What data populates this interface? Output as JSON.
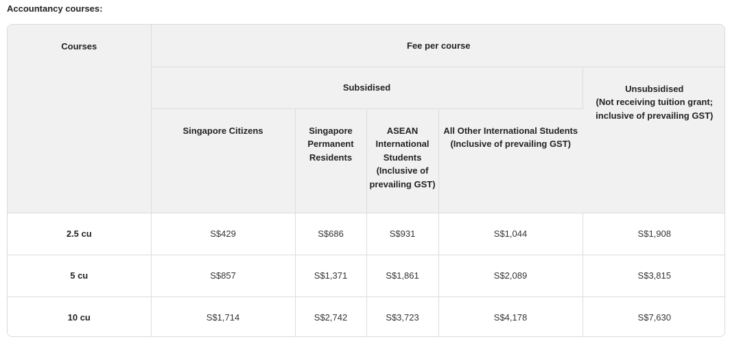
{
  "caption": "Accountancy courses:",
  "header": {
    "courses": "Courses",
    "fee_per_course": "Fee per course",
    "subsidised": "Subsidised",
    "unsubsidised_line1": "Unsubsidised",
    "unsubsidised_line2": "(Not receiving tuition grant;",
    "unsubsidised_line3": "inclusive of prevailing GST)",
    "columns": [
      {
        "lines": [
          "Singapore Citizens"
        ]
      },
      {
        "lines": [
          "Singapore",
          "Permanent",
          "Residents"
        ]
      },
      {
        "lines": [
          "ASEAN",
          "International",
          "Students",
          "(Inclusive of",
          "prevailing GST)"
        ]
      },
      {
        "lines": [
          "All Other International Students",
          "(Inclusive of prevailing GST)"
        ]
      }
    ]
  },
  "rows": [
    {
      "course": "2.5 cu",
      "citizens": "S$429",
      "pr": "S$686",
      "asean": "S$931",
      "other": "S$1,044",
      "unsubsidised": "S$1,908"
    },
    {
      "course": "5 cu",
      "citizens": "S$857",
      "pr": "S$1,371",
      "asean": "S$1,861",
      "other": "S$2,089",
      "unsubsidised": "S$3,815"
    },
    {
      "course": "10 cu",
      "citizens": "S$1,714",
      "pr": "S$2,742",
      "asean": "S$3,723",
      "other": "S$4,178",
      "unsubsidised": "S$7,630"
    }
  ]
}
